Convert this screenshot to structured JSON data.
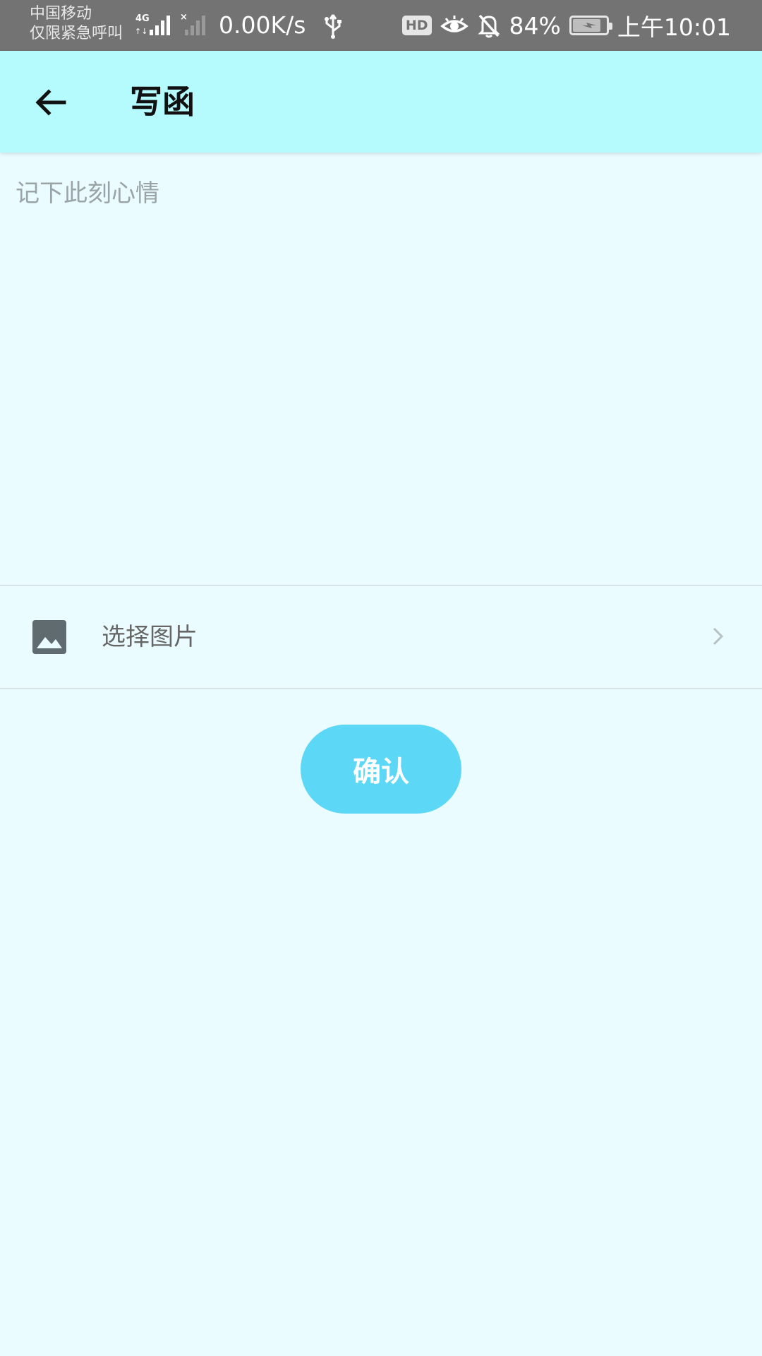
{
  "status_bar": {
    "carrier_line1": "中国移动",
    "carrier_line2": "仅限紧急呼叫",
    "network_type": "4G",
    "net_speed": "0.00K/s",
    "hd_badge": "HD",
    "battery_percent": "84%",
    "battery_level": 0.84,
    "time": "上午10:01"
  },
  "app_bar": {
    "title": "写函",
    "back_icon": "arrow-left-icon"
  },
  "editor": {
    "placeholder": "记下此刻心情",
    "value": ""
  },
  "image_picker": {
    "label": "选择图片",
    "icon": "image-icon",
    "chevron_icon": "chevron-right-icon"
  },
  "actions": {
    "confirm_label": "确认"
  },
  "colors": {
    "status_bar_bg": "#737373",
    "app_bar_bg": "#b5fbfe",
    "page_bg": "#eafcff",
    "button_bg": "#5cd8f6",
    "button_text": "#ffffff"
  }
}
